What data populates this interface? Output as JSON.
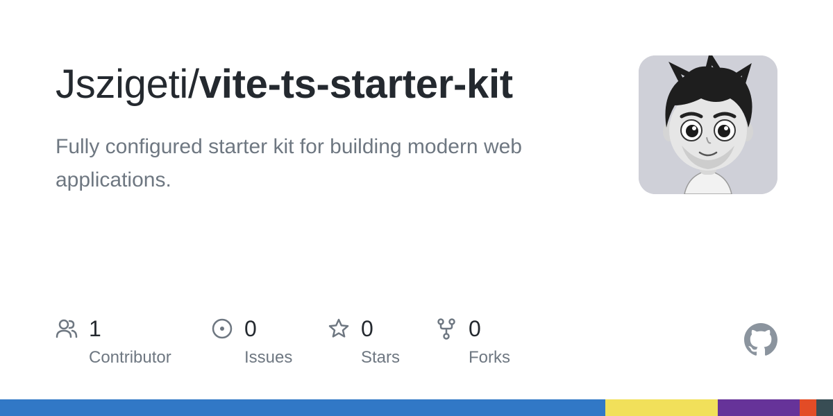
{
  "repo": {
    "owner": "Jszigeti/",
    "name": "vite-ts-starter-kit",
    "description": "Fully configured starter kit for building modern web applications."
  },
  "stats": [
    {
      "icon": "contributors-icon",
      "count": "1",
      "label": "Contributor"
    },
    {
      "icon": "issues-icon",
      "count": "0",
      "label": "Issues"
    },
    {
      "icon": "star-icon",
      "count": "0",
      "label": "Stars"
    },
    {
      "icon": "fork-icon",
      "count": "0",
      "label": "Forks"
    }
  ],
  "languages": [
    {
      "color": "#3178c6",
      "share": 0.727
    },
    {
      "color": "#f1e05a",
      "share": 0.135
    },
    {
      "color": "#663399",
      "share": 0.098
    },
    {
      "color": "#e34c26",
      "share": 0.02
    },
    {
      "color": "#384d54",
      "share": 0.02
    }
  ],
  "colors": {
    "text": "#24292f",
    "muted": "#6e7781",
    "icon": "#6e7781",
    "github_logo": "#8b949e"
  }
}
